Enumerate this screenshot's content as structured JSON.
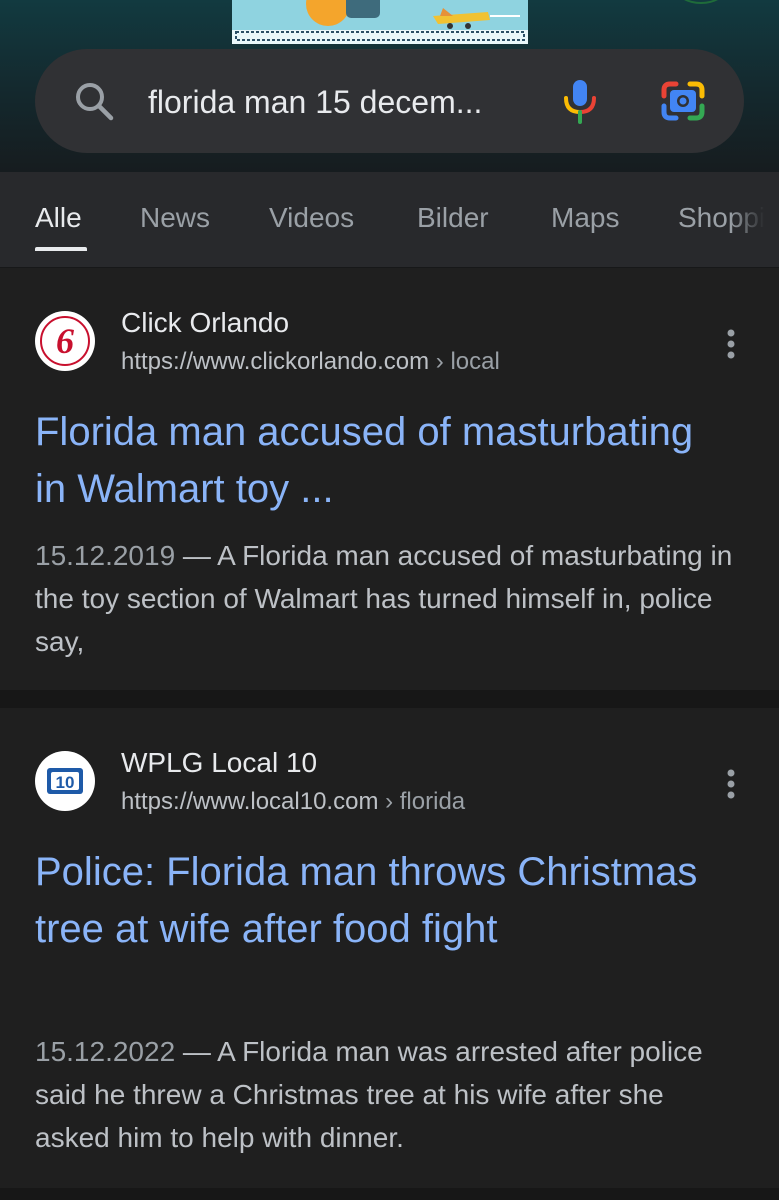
{
  "search": {
    "query": "florida man 15 decem...",
    "colors": {
      "mic_blue": "#4285f4",
      "mic_red": "#ea4335",
      "mic_yellow": "#fbbc04",
      "mic_green": "#34a853"
    }
  },
  "tabs": [
    {
      "label": "Alle",
      "active": true
    },
    {
      "label": "News"
    },
    {
      "label": "Videos"
    },
    {
      "label": "Bilder"
    },
    {
      "label": "Maps"
    },
    {
      "label": "Shoppi"
    }
  ],
  "results": [
    {
      "site_name": "Click Orlando",
      "url_host": "https://www.clickorlando.com",
      "url_path": " › local",
      "favicon": "channel-6-logo-icon",
      "title": "Florida man accused of masturbating in Walmart toy ...",
      "date": "15.12.2019",
      "snippet": " — A Florida man accused of masturbating in the toy section of Walmart has turned himself in, police say,"
    },
    {
      "site_name": "WPLG Local 10",
      "url_host": "https://www.local10.com",
      "url_path": " › florida",
      "favicon": "local-10-logo-icon",
      "title": "Police: Florida man throws Christmas tree at wife after food fight",
      "date": "15.12.2022",
      "snippet": " — A Florida man was arrested after police said he threw a Christmas tree at his wife after she asked him to help with dinner."
    }
  ],
  "theme": {
    "background": "#1f1f1f",
    "link_color": "#8ab4f8",
    "tab_bar": "#28292c",
    "search_bar": "#303134"
  }
}
